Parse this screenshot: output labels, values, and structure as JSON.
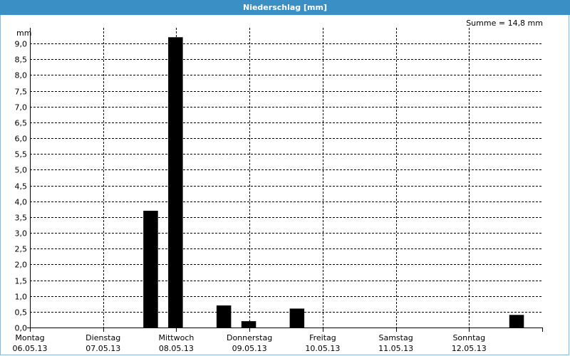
{
  "window": {
    "title": "Niederschlag [mm]"
  },
  "chart_data": {
    "type": "bar",
    "title": "Niederschlag [mm]",
    "ylabel": "mm",
    "sum_label": "Summe = 14,8 mm",
    "ylim": [
      0,
      9.5
    ],
    "yticks": [
      "0,0",
      "0,5",
      "1,0",
      "1,5",
      "2,0",
      "2,5",
      "3,0",
      "3,5",
      "4,0",
      "4,5",
      "5,0",
      "5,5",
      "6,0",
      "6,5",
      "7,0",
      "7,5",
      "8,0",
      "8,5",
      "9,0"
    ],
    "ytick_values": [
      0,
      0.5,
      1,
      1.5,
      2,
      2.5,
      3,
      3.5,
      4,
      4.5,
      5,
      5.5,
      6,
      6.5,
      7,
      7.5,
      8,
      8.5,
      9
    ],
    "days": [
      {
        "name": "Montag",
        "date": "06.05.13"
      },
      {
        "name": "Dienstag",
        "date": "07.05.13"
      },
      {
        "name": "Mittwoch",
        "date": "08.05.13"
      },
      {
        "name": "Donnerstag",
        "date": "09.05.13"
      },
      {
        "name": "Freitag",
        "date": "10.05.13"
      },
      {
        "name": "Samstag",
        "date": "11.05.13"
      },
      {
        "name": "Sonntag",
        "date": "12.05.13"
      }
    ],
    "bar_width_days": 0.2,
    "bars": [
      {
        "t": 1.55,
        "value": 3.7
      },
      {
        "t": 1.89,
        "value": 9.2
      },
      {
        "t": 2.55,
        "value": 0.7
      },
      {
        "t": 2.89,
        "value": 0.2
      },
      {
        "t": 3.55,
        "value": 0.6
      },
      {
        "t": 6.55,
        "value": 0.4
      }
    ],
    "bar_color": "#000000",
    "grid": true
  }
}
